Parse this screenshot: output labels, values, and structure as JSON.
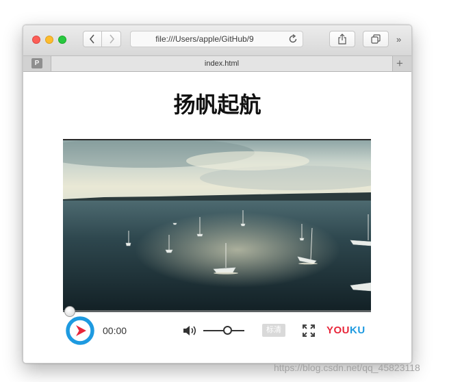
{
  "browser": {
    "url": "file:///Users/apple/GitHub/9",
    "tab_title": "index.html",
    "pinned_tab_letter": "P",
    "more_glyph": "»",
    "new_tab_glyph": "+"
  },
  "page": {
    "heading": "扬帆起航"
  },
  "player": {
    "current_time": "00:00",
    "progress": 0,
    "volume": 0.5,
    "quality_label": "标清",
    "brand": {
      "you": "YOU",
      "ku": "KU"
    },
    "colors": {
      "youku_red": "#e8263a",
      "youku_blue": "#1e9ae0"
    },
    "icons": [
      "youku-play-icon",
      "volume-icon",
      "fullscreen-icon"
    ]
  },
  "watermark": "https://blog.csdn.net/qq_45823118",
  "colors": {
    "close": "#fc5f57",
    "minimize": "#fdbc2e",
    "zoom": "#28c840"
  }
}
